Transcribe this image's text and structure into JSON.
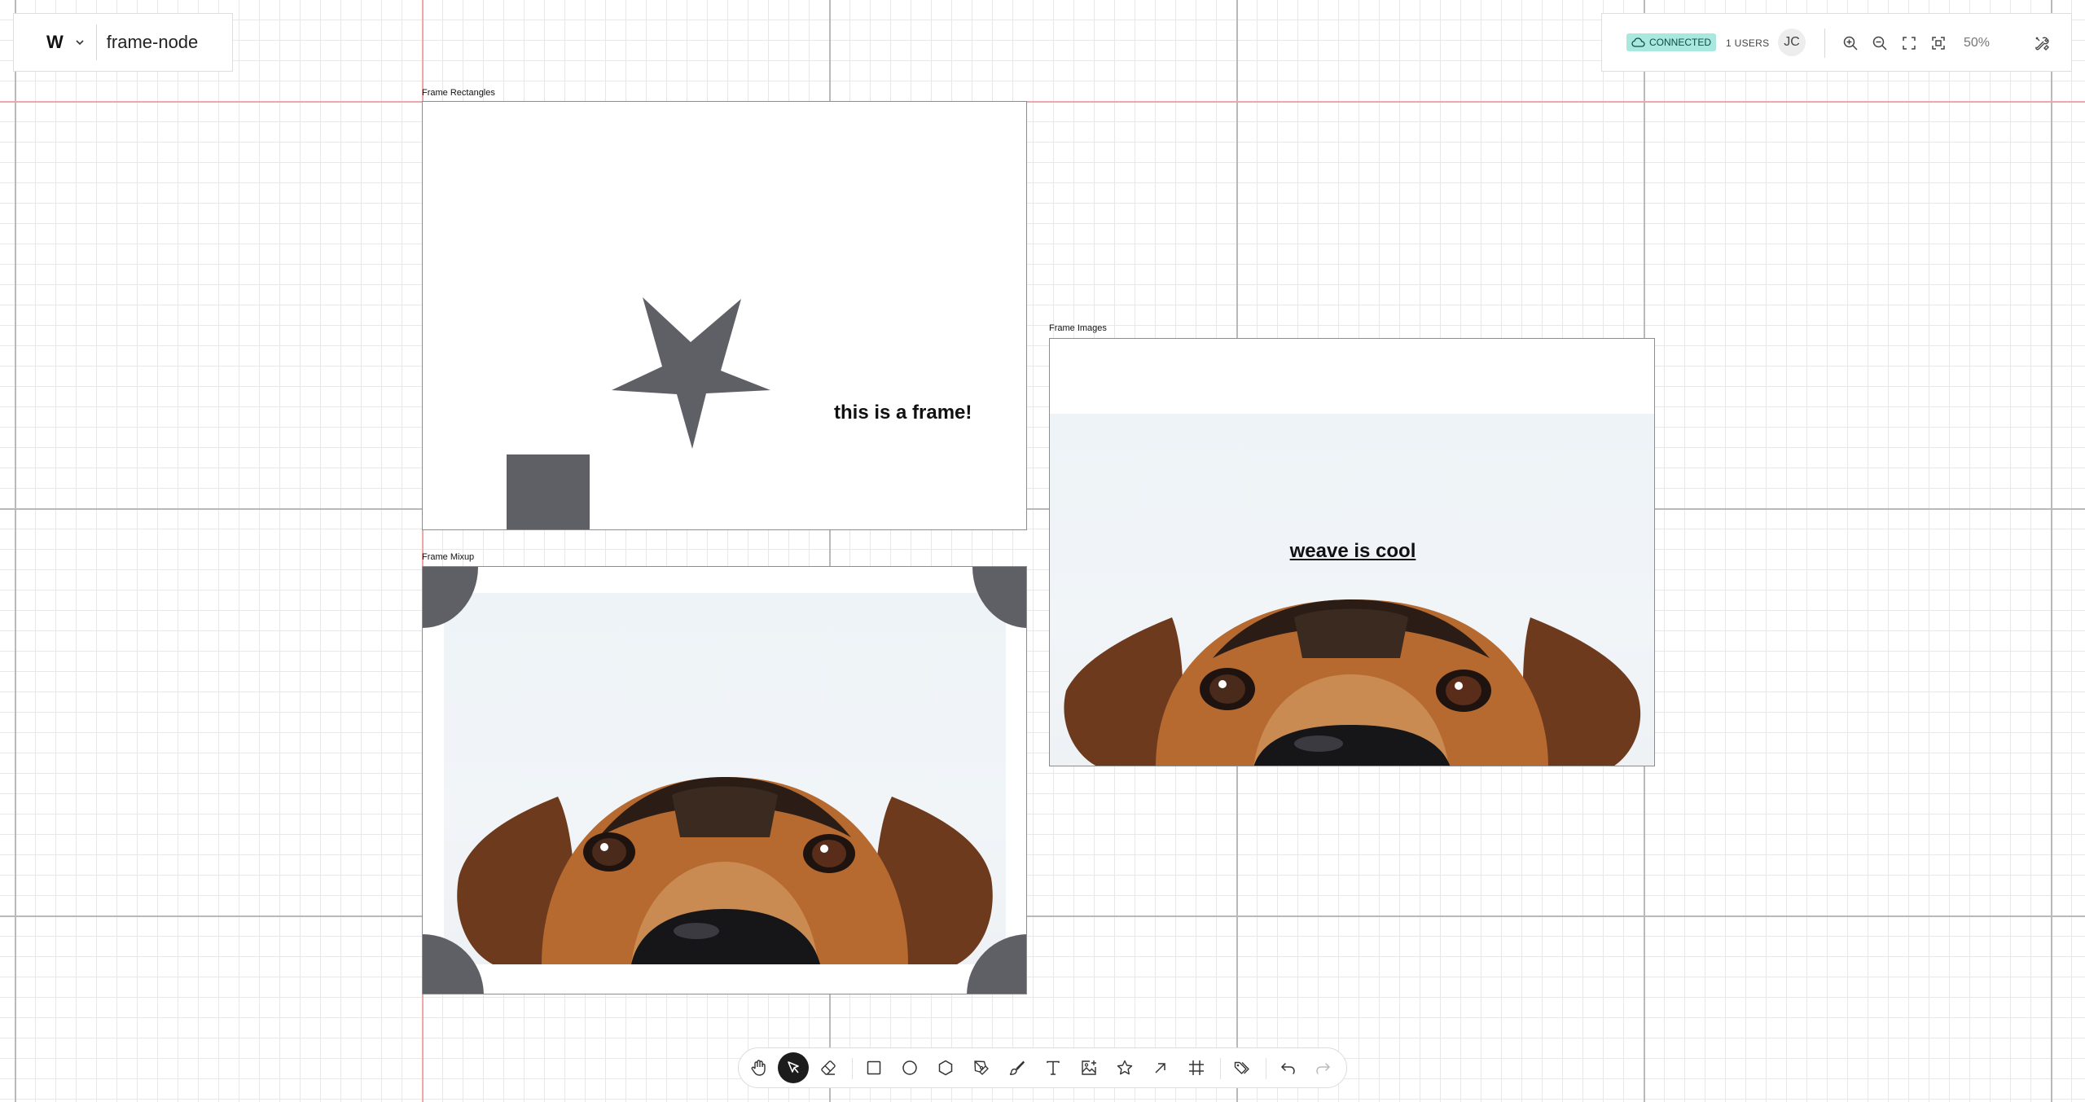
{
  "document": {
    "logo": "W",
    "name": "frame-node"
  },
  "status": {
    "connection": "CONNECTED",
    "users": "1 USERS",
    "avatar_initials": "JC",
    "zoom": "50%",
    "accent_color": "#a9e8de"
  },
  "frames": {
    "rectangles": {
      "label": "Frame Rectangles",
      "text": "this is a frame!",
      "shape_color": "#5f5f66"
    },
    "images": {
      "label": "Frame Images",
      "text": "weave is cool"
    },
    "mixup": {
      "label": "Frame Mixup",
      "shape_color": "#5f5f66"
    }
  },
  "toolbar": {
    "tools": [
      {
        "name": "hand-icon"
      },
      {
        "name": "select-icon",
        "active": true
      },
      {
        "name": "eraser-icon"
      },
      {
        "name": "rectangle-icon"
      },
      {
        "name": "ellipse-icon"
      },
      {
        "name": "polygon-icon"
      },
      {
        "name": "pen-icon"
      },
      {
        "name": "brush-icon"
      },
      {
        "name": "text-icon"
      },
      {
        "name": "image-icon"
      },
      {
        "name": "star-icon"
      },
      {
        "name": "arrow-icon"
      },
      {
        "name": "frame-icon"
      },
      {
        "name": "tags-icon"
      },
      {
        "name": "undo-icon"
      },
      {
        "name": "redo-icon"
      }
    ]
  }
}
